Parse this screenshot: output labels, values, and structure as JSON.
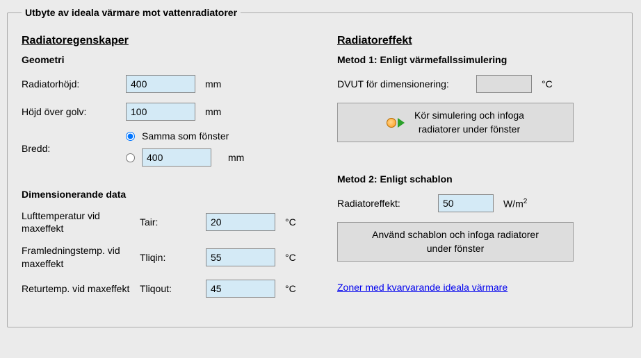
{
  "fieldset_title": "Utbyte av ideala värmare mot vattenradiatorer",
  "left": {
    "section_title": "Radiatoregenskaper",
    "geom_heading": "Geometri",
    "height_label": "Radiatorhöjd:",
    "height_value": "400",
    "height_unit": "mm",
    "abovefloor_label": "Höjd över golv:",
    "abovefloor_value": "100",
    "abovefloor_unit": "mm",
    "width_label": "Bredd:",
    "width_same_label": "Samma som fönster",
    "width_value": "400",
    "width_unit": "mm",
    "dim_heading": "Dimensionerande data",
    "tair_label": "Lufttemperatur vid maxeffekt",
    "tair_sym": "Tair:",
    "tair_value": "20",
    "tair_unit": "°C",
    "tliqin_label": "Framledningstemp. vid maxeffekt",
    "tliqin_sym": "Tliqin:",
    "tliqin_value": "55",
    "tliqin_unit": "°C",
    "tliqout_label": "Returtemp. vid maxeffekt",
    "tliqout_sym": "Tliqout:",
    "tliqout_value": "45",
    "tliqout_unit": "°C"
  },
  "right": {
    "section_title": "Radiatoreffekt",
    "method1_heading": "Metod 1: Enligt värmefallssimulering",
    "dvut_label": "DVUT för dimensionering:",
    "dvut_value": "",
    "dvut_unit": "°C",
    "run_button_line1": "Kör simulering och infoga",
    "run_button_line2": "radiatorer under fönster",
    "method2_heading": "Metod 2: Enligt schablon",
    "radeff_label": "Radiatoreffekt:",
    "radeff_value": "50",
    "radeff_unit_base": "W/m",
    "template_button_line1": "Använd schablon och infoga radiatorer",
    "template_button_line2": "under fönster",
    "link_text": "Zoner med kvarvarande ideala värmare"
  }
}
